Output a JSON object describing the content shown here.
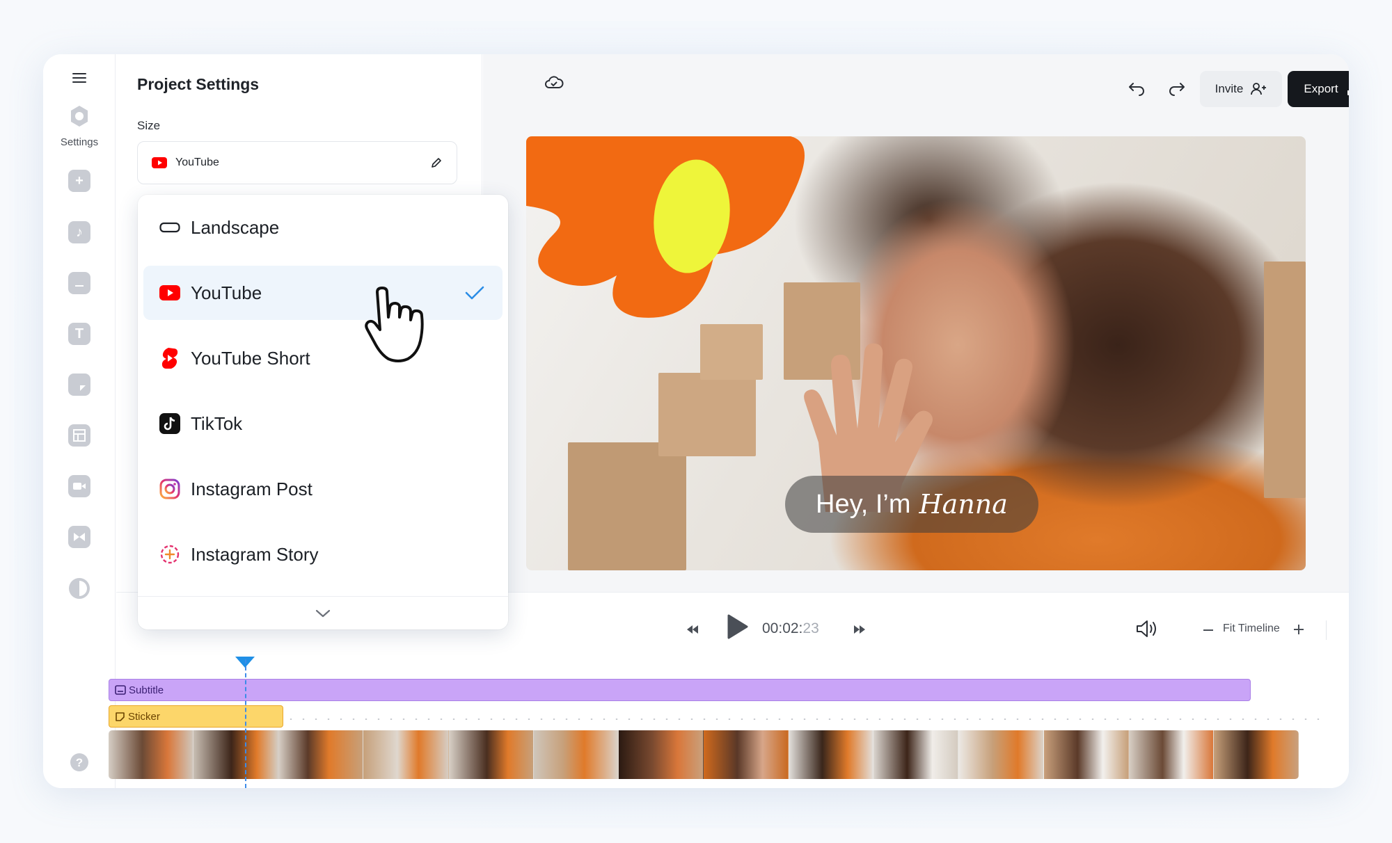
{
  "rail": {
    "menu_icon": "hamburger-icon",
    "settings_label": "Settings",
    "help_icon": "question-icon"
  },
  "panel": {
    "title": "Project Settings",
    "size_label": "Size",
    "size_value": "YouTube"
  },
  "dropdown": {
    "items": [
      {
        "label": "Landscape",
        "icon": "landscape-icon"
      },
      {
        "label": "YouTube",
        "icon": "youtube-icon",
        "selected": true
      },
      {
        "label": "YouTube Short",
        "icon": "youtube-shorts-icon"
      },
      {
        "label": "TikTok",
        "icon": "tiktok-icon"
      },
      {
        "label": "Instagram Post",
        "icon": "instagram-icon"
      },
      {
        "label": "Instagram Story",
        "icon": "instagram-story-icon"
      }
    ]
  },
  "topbar": {
    "invite_label": "Invite",
    "export_label": "Export"
  },
  "video": {
    "caption_prefix": "Hey, I’m",
    "caption_name": "Hanna"
  },
  "controls": {
    "time_main": "00:02:",
    "time_frames": "23",
    "fit_label": "Fit Timeline"
  },
  "timeline": {
    "subtitle_label": "Subtitle",
    "sticker_label": "Sticker"
  },
  "colors": {
    "accent": "#1f8fe6",
    "subtitle": "#c9a4f7",
    "sticker": "#fcd66a",
    "flower": "#f26a12",
    "flower_center": "#eef53a"
  }
}
